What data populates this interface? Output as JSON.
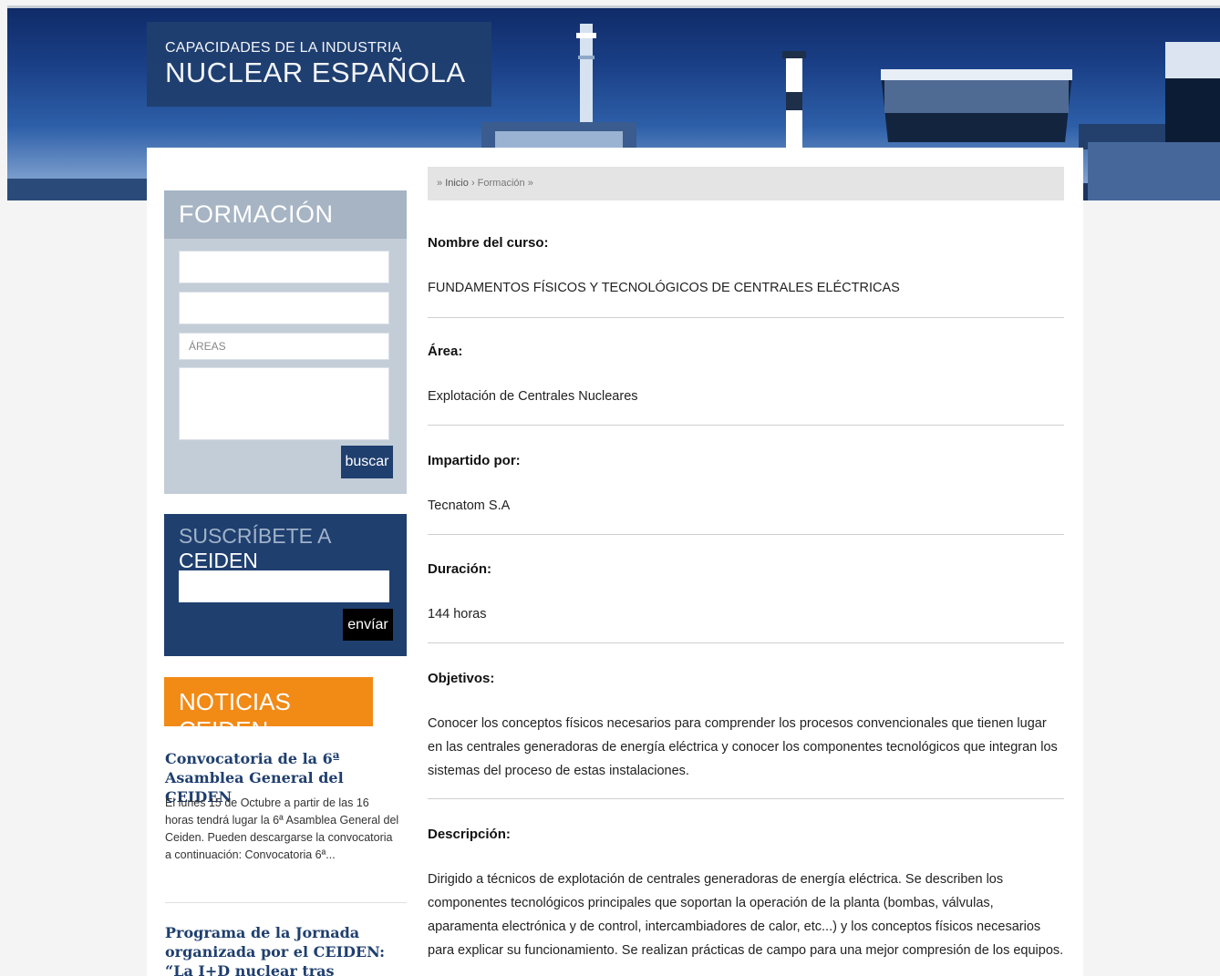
{
  "header": {
    "title_small": "CAPACIDADES DE LA INDUSTRIA",
    "title_big": "NUCLEAR ESPAÑOLA"
  },
  "sidebar": {
    "formacion": {
      "heading": "FORMACIÓN",
      "areas_placeholder": "ÁREAS",
      "search_button": "buscar"
    },
    "subscribe": {
      "heading_prefix": "SUSCRÍBETE A",
      "heading_brand": "CEIDEN",
      "send_button": "envíar"
    },
    "news": {
      "heading": "NOTICIAS CEIDEN",
      "items": [
        {
          "title": "Convocatoria de la 6ª Asamblea General del CEIDEN",
          "excerpt": "El lunes 15 de Octubre a partir de las 16 horas tendrá lugar la 6ª Asamblea General del Ceiden. Pueden descargarse la convocatoria a continuación: Convocatoria 6ª..."
        },
        {
          "title": "Programa de la Jornada organizada por el CEIDEN: “La I+D nuclear tras Fukushima”"
        }
      ]
    }
  },
  "breadcrumb": {
    "prefix": "»",
    "home": "Inicio",
    "sep": "›",
    "current": "Formación",
    "suffix": "»"
  },
  "course": {
    "name_label": "Nombre del curso:",
    "name_value": "FUNDAMENTOS FÍSICOS Y TECNOLÓGICOS DE CENTRALES ELÉCTRICAS",
    "area_label": "Área:",
    "area_value": "Explotación de Centrales Nucleares",
    "provider_label": "Impartido por:",
    "provider_value": "Tecnatom S.A",
    "duration_label": "Duración:",
    "duration_value": "144 horas",
    "objectives_label": "Objetivos:",
    "objectives_value": "Conocer los conceptos físicos necesarios para comprender los procesos convencionales que tienen lugar en las centrales generadoras de energía eléctrica y conocer los componentes tecnológicos que integran los sistemas del proceso de estas instalaciones.",
    "description_label": "Descripción:",
    "description_value": "Dirigido a técnicos de explotación de centrales generadoras de energía eléctrica. Se describen los componentes tecnológicos principales que soportan la operación de la planta (bombas, válvulas, aparamenta electrónica y de control, intercambiadores de calor, etc...) y los conceptos físicos necesarios para explicar su funcionamiento. Se realizan prácticas de campo para una mejor compresión de los equipos."
  },
  "colors": {
    "navy": "#1f3f6f",
    "orange": "#f28a16",
    "sidebar_panel": "#c3cdd8"
  }
}
